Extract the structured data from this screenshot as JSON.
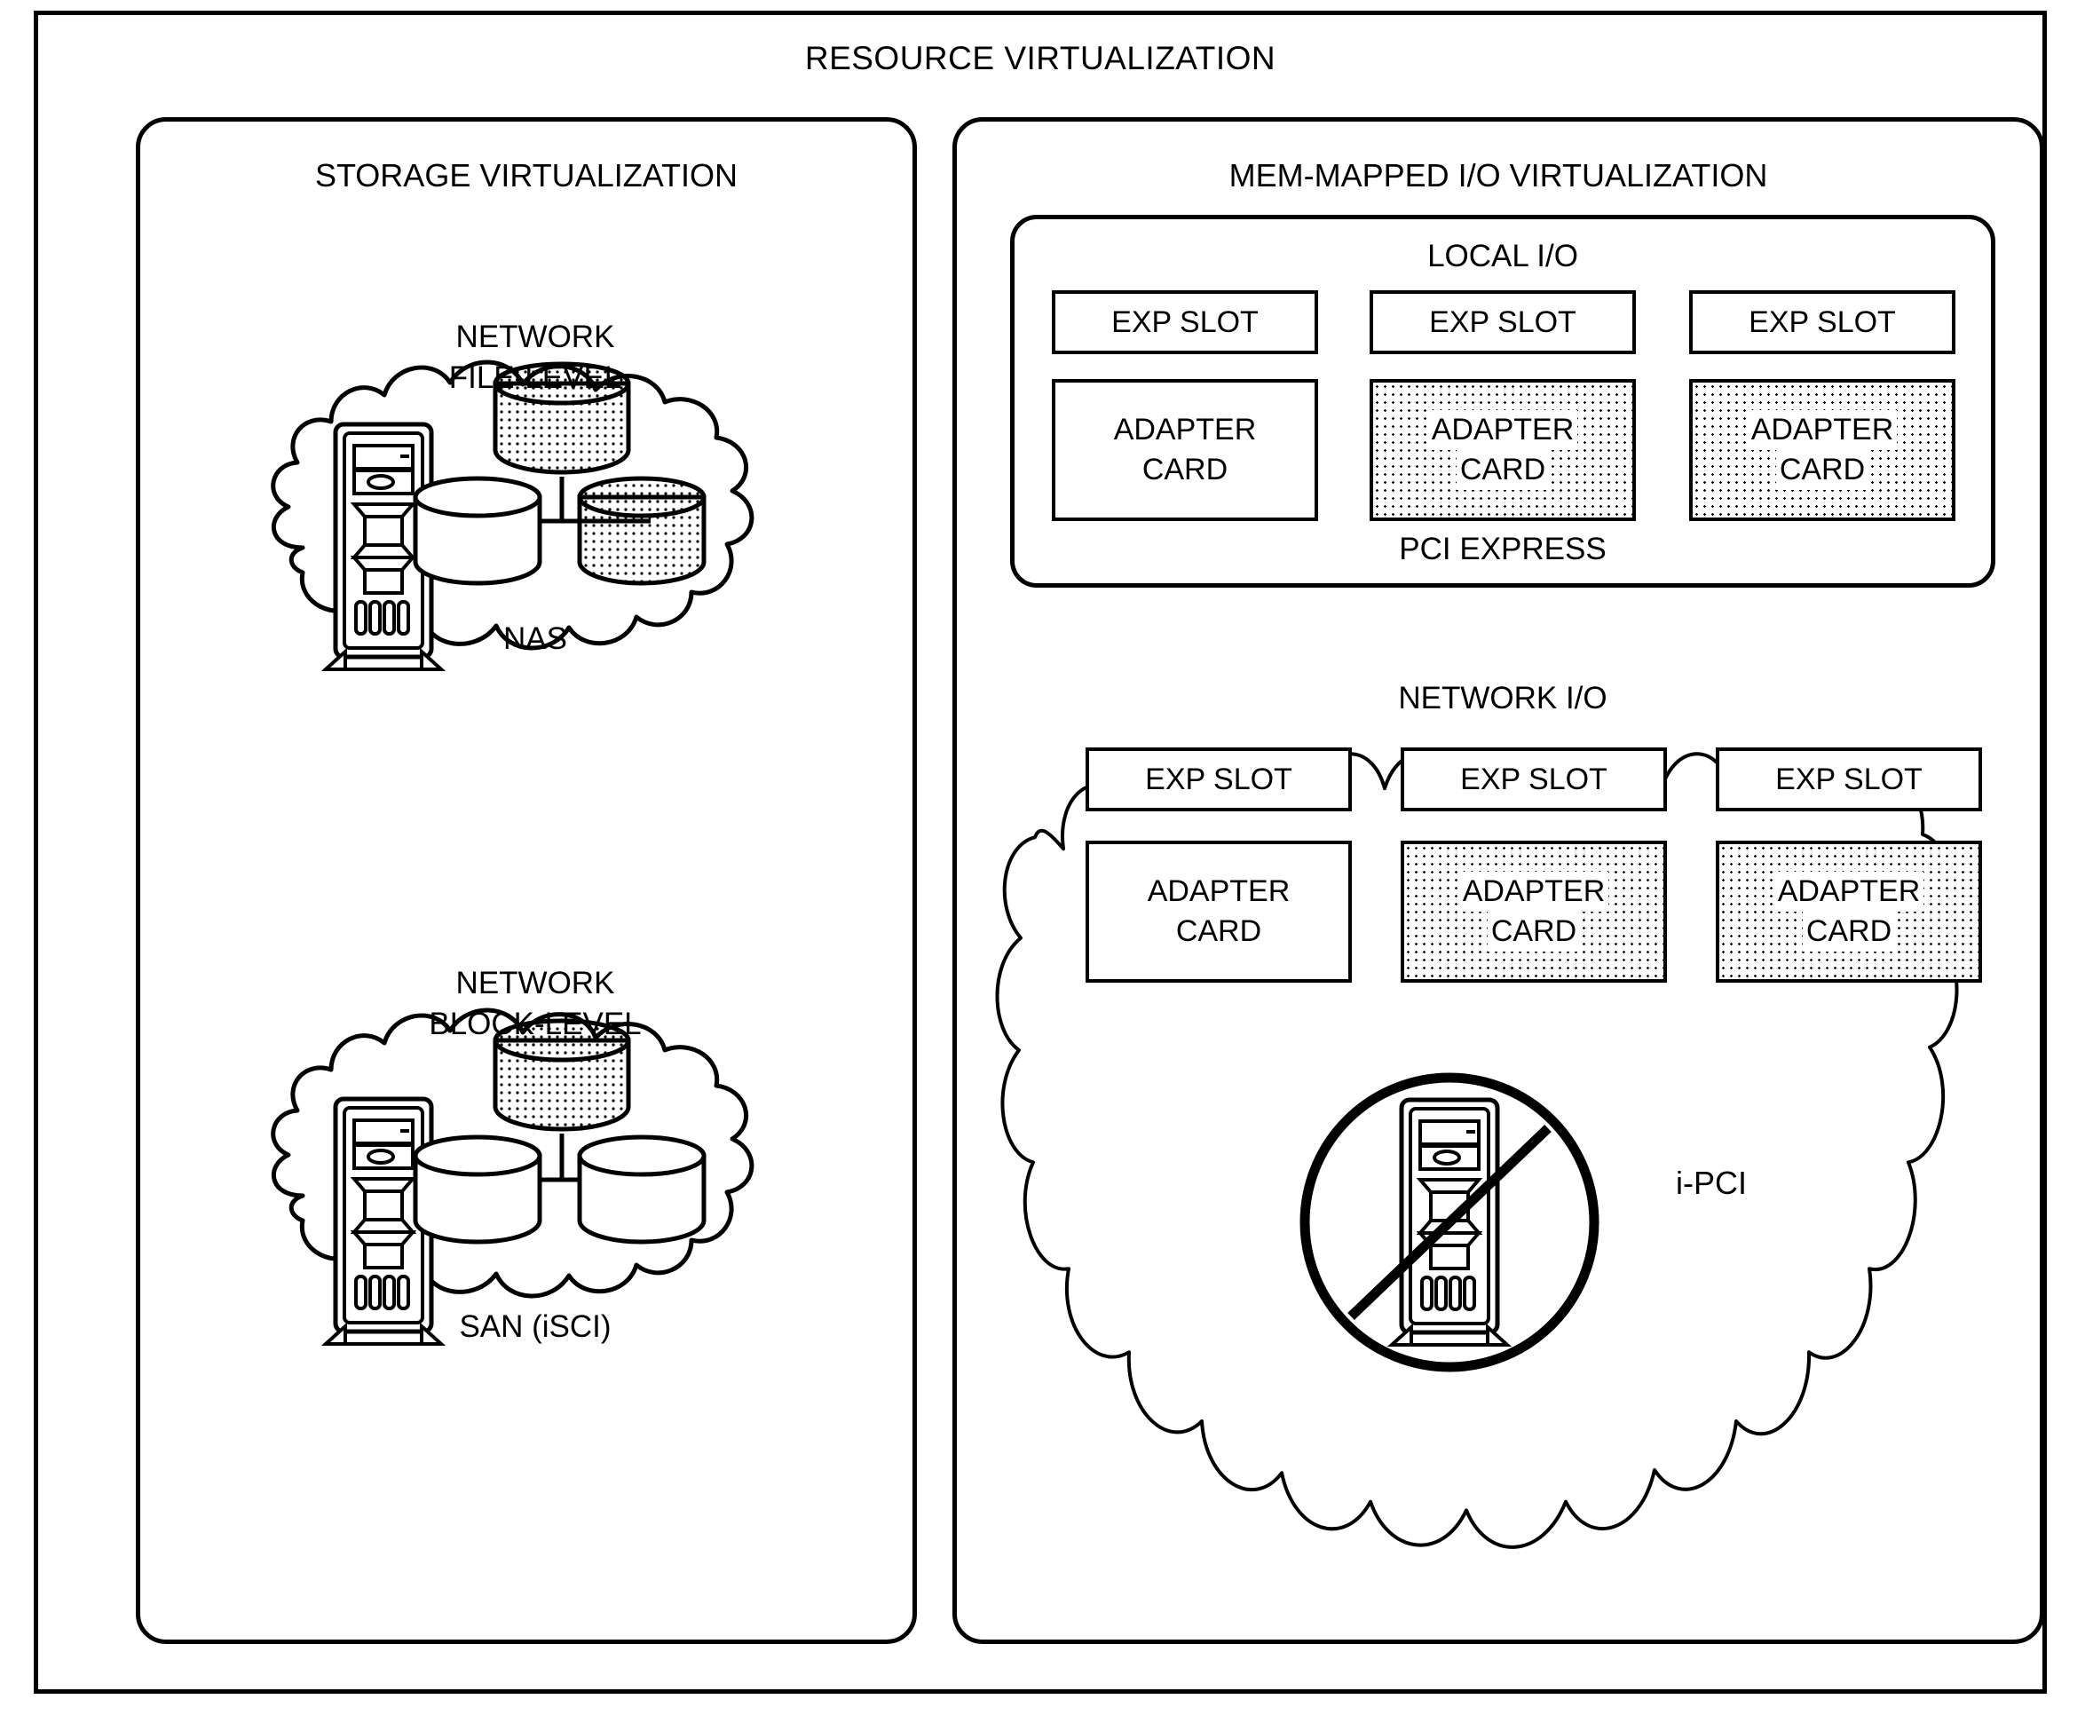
{
  "diagram": {
    "title": "RESOURCE VIRTUALIZATION",
    "storage_panel": {
      "title": "STORAGE VIRTUALIZATION",
      "clouds": [
        {
          "id": "nas",
          "title_line1": "NETWORK",
          "title_line2": "FILE-LEVEL",
          "name": "NAS",
          "icons": [
            "server-tower",
            "disk-cylinder-shaded",
            "disk-cylinder-plain",
            "disk-cylinder-shaded"
          ]
        },
        {
          "id": "san",
          "title_line1": "NETWORK",
          "title_line2": "BLOCK-LEVEL",
          "name": "SAN (iSCI)",
          "icons": [
            "server-tower",
            "disk-cylinder-shaded",
            "disk-cylinder-plain",
            "disk-cylinder-plain"
          ]
        }
      ]
    },
    "mmio_panel": {
      "title": "MEM-MAPPED I/O VIRTUALIZATION",
      "local_io": {
        "title": "LOCAL I/O",
        "footer": "PCI EXPRESS",
        "slots": [
          {
            "label": "EXP SLOT"
          },
          {
            "label": "EXP SLOT"
          },
          {
            "label": "EXP SLOT"
          }
        ],
        "cards": [
          {
            "line1": "ADAPTER",
            "line2": "CARD",
            "shaded": false
          },
          {
            "line1": "ADAPTER",
            "line2": "CARD",
            "shaded": true
          },
          {
            "line1": "ADAPTER",
            "line2": "CARD",
            "shaded": true
          }
        ]
      },
      "network_io": {
        "title": "NETWORK I/O",
        "interconnect": "i-PCI",
        "slots": [
          {
            "label": "EXP SLOT"
          },
          {
            "label": "EXP SLOT"
          },
          {
            "label": "EXP SLOT"
          }
        ],
        "cards": [
          {
            "line1": "ADAPTER",
            "line2": "CARD",
            "shaded": false
          },
          {
            "line1": "ADAPTER",
            "line2": "CARD",
            "shaded": true
          },
          {
            "line1": "ADAPTER",
            "line2": "CARD",
            "shaded": true
          }
        ],
        "prohibited_icon": "server-tower-no-symbol"
      }
    },
    "colors": {
      "line": "#000000",
      "background": "#ffffff"
    }
  }
}
